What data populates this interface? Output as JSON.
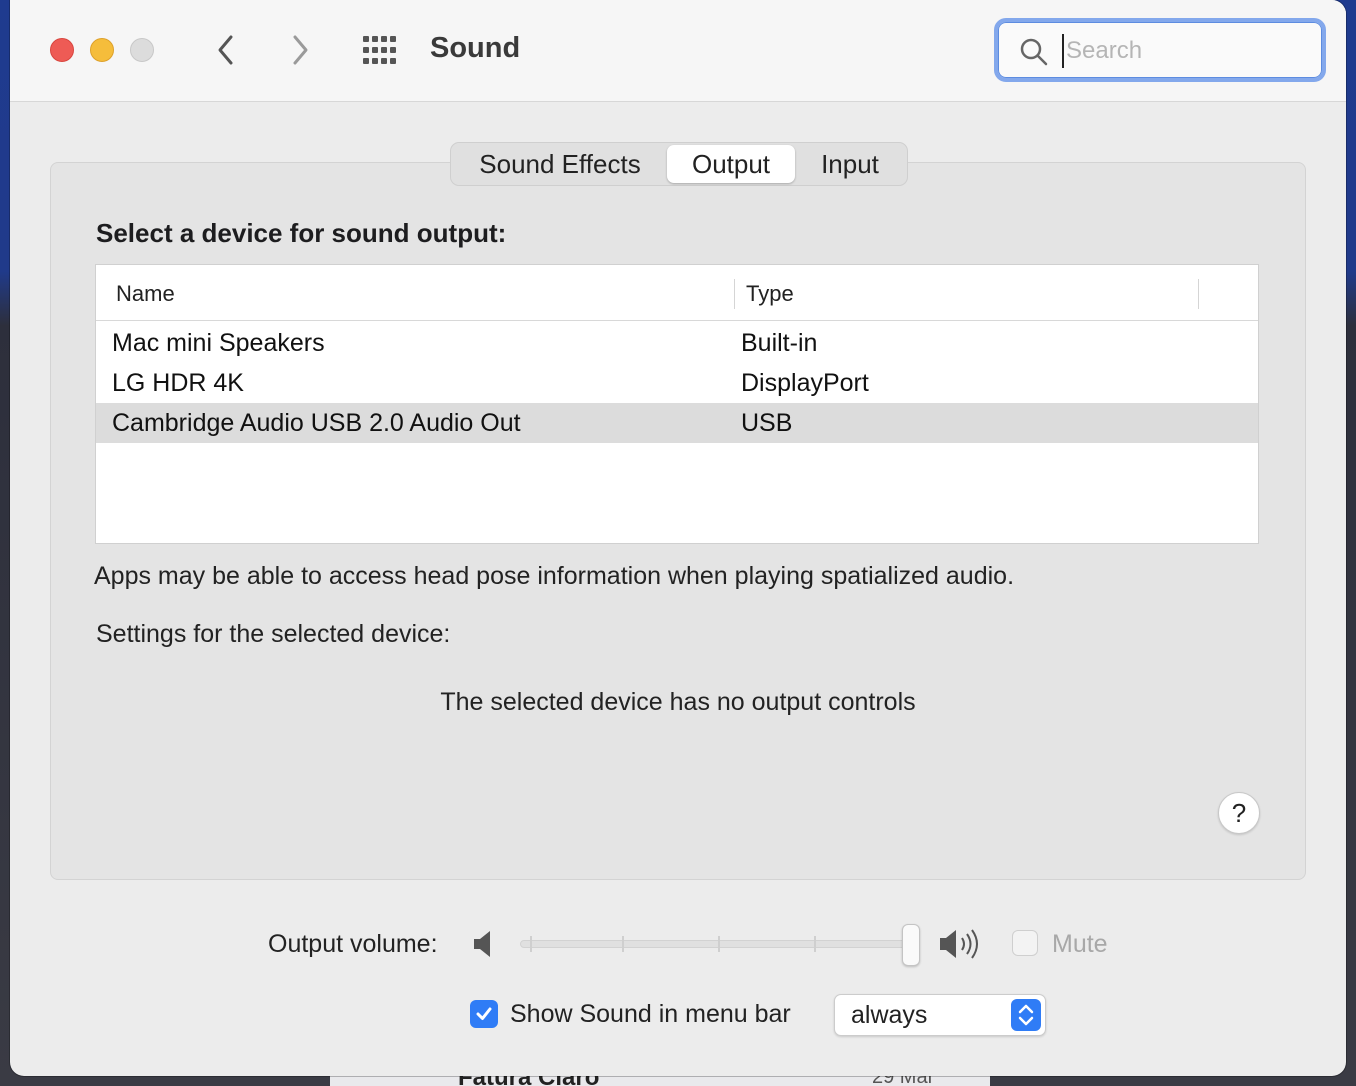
{
  "window": {
    "title": "Sound"
  },
  "search": {
    "placeholder": "Search",
    "value": ""
  },
  "tabs": [
    {
      "label": "Sound Effects",
      "selected": false
    },
    {
      "label": "Output",
      "selected": true
    },
    {
      "label": "Input",
      "selected": false
    }
  ],
  "output": {
    "heading": "Select a device for sound output:",
    "columns": {
      "name": "Name",
      "type": "Type"
    },
    "devices": [
      {
        "name": "Mac mini Speakers",
        "type": "Built-in",
        "selected": false
      },
      {
        "name": "LG HDR 4K",
        "type": "DisplayPort",
        "selected": false
      },
      {
        "name": "Cambridge Audio USB 2.0 Audio Out",
        "type": "USB",
        "selected": true
      }
    ],
    "info_text": "Apps may be able to access head pose information when playing spatialized audio.",
    "settings_label": "Settings for the selected device:",
    "no_controls_text": "The selected device has no output controls",
    "help_label": "?"
  },
  "volume": {
    "label": "Output volume:",
    "level": 1.0,
    "mute_label": "Mute",
    "muted": false,
    "mute_enabled": false
  },
  "menu_bar": {
    "checkbox_label": "Show Sound in menu bar",
    "checked": true,
    "popup_value": "always"
  },
  "background": {
    "partial_text": "Fatura Claro",
    "partial_date": "29 Mar"
  },
  "colors": {
    "accent": "#2f7cf6",
    "close": "#ee5b55",
    "minimize": "#f5bd3b",
    "zoom_disabled": "#dcdcdc",
    "search_focus": "#83a8ec",
    "selected_row": "#dcdcdc"
  },
  "icons": {
    "back": "chevron-left-icon",
    "forward": "chevron-right-icon",
    "grid": "grid-icon",
    "search": "search-icon",
    "speaker_low": "speaker-low-icon",
    "speaker_high": "speaker-high-icon",
    "checkmark": "checkmark-icon",
    "popup_arrows": "up-down-arrows-icon"
  }
}
